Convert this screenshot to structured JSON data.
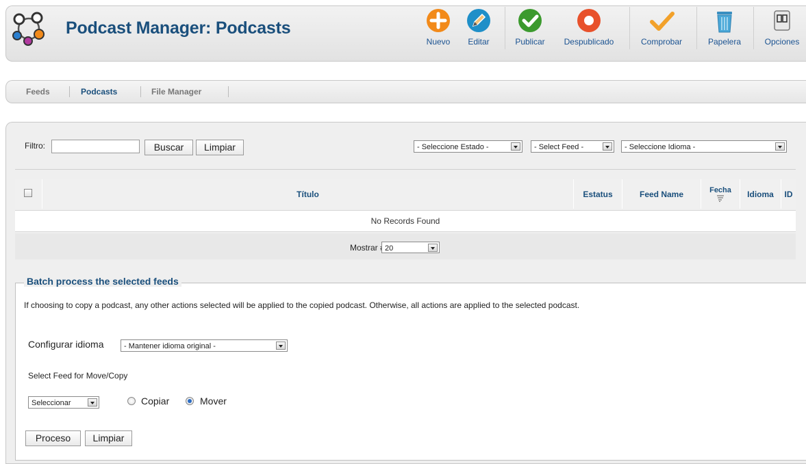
{
  "header": {
    "title": "Podcast Manager: Podcasts",
    "toolbar": {
      "new": "Nuevo",
      "edit": "Editar",
      "publish": "Publicar",
      "unpublish": "Despublicado",
      "check": "Comprobar",
      "trash": "Papelera",
      "options": "Opciones"
    }
  },
  "submenu": {
    "feeds": "Feeds",
    "podcasts": "Podcasts",
    "file_manager": "File Manager"
  },
  "filter": {
    "label": "Filtro:",
    "input_value": "",
    "search_button": "Buscar",
    "clear_button": "Limpiar",
    "state_select": "- Seleccione Estado -",
    "feed_select": "- Select Feed -",
    "language_select": "- Seleccione Idioma -"
  },
  "table": {
    "columns": [
      "Título",
      "Estatus",
      "Feed Name",
      "Fecha",
      "Idioma",
      "ID"
    ],
    "empty_message": "No Records Found",
    "show_label": "Mostrar #",
    "show_value": "20"
  },
  "batch": {
    "legend": "Batch process the selected feeds",
    "description": "If choosing to copy a podcast, any other actions selected will be applied to the copied podcast. Otherwise, all actions are applied to the selected podcast.",
    "language_label": "Configurar idioma",
    "language_select": "- Mantener idioma original -",
    "feed_label": "Select Feed for Move/Copy",
    "feed_select": "Seleccionar",
    "copy_label": "Copiar",
    "move_label": "Mover",
    "selected_action": "move",
    "process_button": "Proceso",
    "clear_button": "Limpiar"
  },
  "colors": {
    "title_blue": "#1a4f7c",
    "new_orange": "#f28a1a",
    "edit_blue": "#1f8fc8",
    "publish_green": "#3c9a2e",
    "unpublish_red": "#e8512b",
    "check_orange": "#f2a12a",
    "trash_blue": "#4aa8d8"
  }
}
